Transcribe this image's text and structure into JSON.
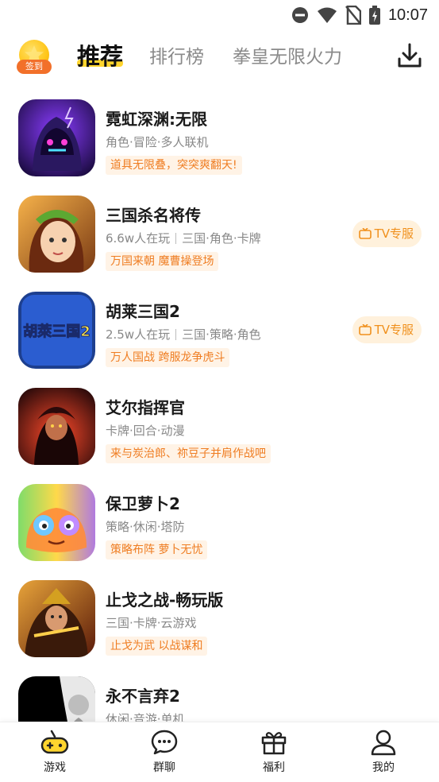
{
  "status_bar": {
    "time": "10:07"
  },
  "header": {
    "checkin_label": "签到",
    "tabs": [
      {
        "label": "推荐",
        "active": true
      },
      {
        "label": "排行榜",
        "active": false
      },
      {
        "label": "拳皇无限火力",
        "active": false
      }
    ]
  },
  "games": [
    {
      "name": "霓虹深渊:无限",
      "meta": [
        "角色·冒险·多人联机"
      ],
      "tag": "道具无限叠，突突爽翻天!",
      "tv": ""
    },
    {
      "name": "三国杀名将传",
      "meta": [
        "6.6w人在玩",
        "三国·角色·卡牌"
      ],
      "tag": "万国来朝 魔曹操登场",
      "tv": "TV专服"
    },
    {
      "name": "胡莱三国2",
      "meta": [
        "2.5w人在玩",
        "三国·策略·角色"
      ],
      "tag": "万人国战 跨服龙争虎斗",
      "tv": "TV专服"
    },
    {
      "name": "艾尔指挥官",
      "meta": [
        "卡牌·回合·动漫"
      ],
      "tag": "来与炭治郎、祢豆子并肩作战吧",
      "tv": ""
    },
    {
      "name": "保卫萝卜2",
      "meta": [
        "策略·休闲·塔防"
      ],
      "tag": "策略布阵 萝卜无忧",
      "tv": ""
    },
    {
      "name": "止戈之战-畅玩版",
      "meta": [
        "三国·卡牌·云游戏"
      ],
      "tag": "止戈为武 以战谋和",
      "tv": ""
    },
    {
      "name": "永不言弃2",
      "meta": [
        "休闲·音游·单机"
      ],
      "tag": "",
      "tv": ""
    }
  ],
  "icon_art": [
    {
      "name": "neon-abyss-icon",
      "label": ""
    },
    {
      "name": "sanguosha-icon",
      "label": ""
    },
    {
      "name": "hulai-sanguo-icon",
      "label": "胡萊三国2"
    },
    {
      "name": "aier-commander-icon",
      "label": ""
    },
    {
      "name": "carrot-fantasy-icon",
      "label": ""
    },
    {
      "name": "zhige-war-icon",
      "label": ""
    },
    {
      "name": "never-give-up-icon",
      "label": ""
    }
  ],
  "bottom_nav": [
    {
      "label": "游戏",
      "icon": "gamepad-icon",
      "active": true
    },
    {
      "label": "群聊",
      "icon": "chat-icon",
      "active": false
    },
    {
      "label": "福利",
      "icon": "gift-icon",
      "active": false
    },
    {
      "label": "我的",
      "icon": "profile-icon",
      "active": false
    }
  ],
  "colors": {
    "accent": "#ffd52e",
    "tag_text": "#ef7d22",
    "tag_bg": "#fff3e6",
    "tv_bg": "#fff1dc"
  }
}
